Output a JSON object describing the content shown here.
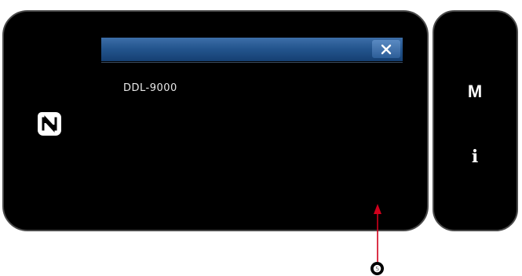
{
  "popup": {
    "model_name": "DDL-9000",
    "close_icon": "close-icon"
  },
  "logo": {
    "icon": "nfc-n-mark-icon"
  },
  "side_panel": {
    "mode_button_label": "M",
    "info_button_label": "i"
  },
  "annotation": {
    "callout_number": "❺",
    "color": "#d0001c"
  }
}
